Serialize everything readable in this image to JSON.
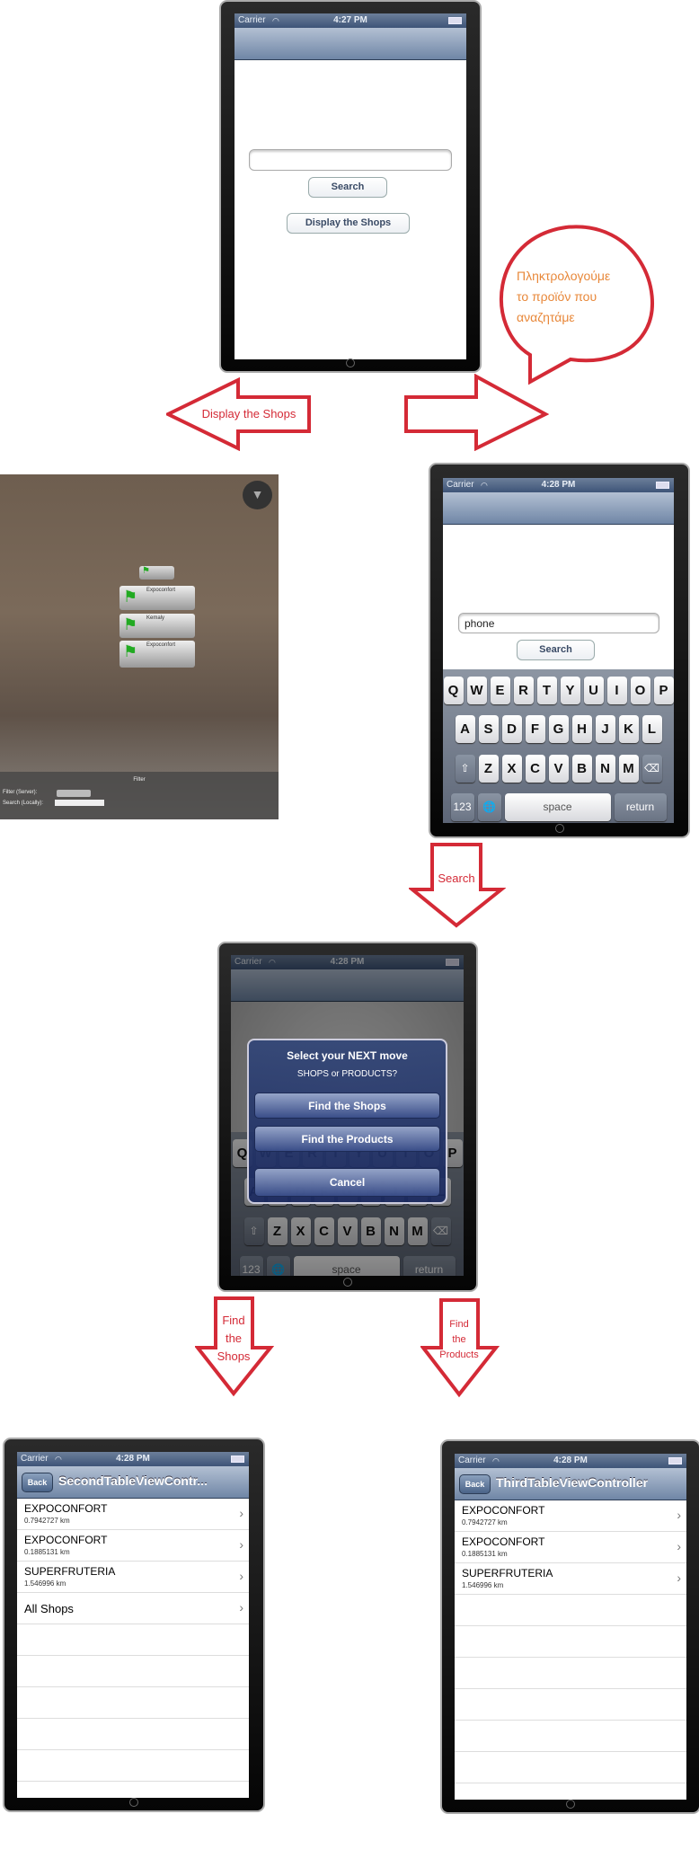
{
  "phone_home": {
    "status": {
      "carrier": "Carrier",
      "time": "4:27 PM"
    },
    "search_input": {
      "value": ""
    },
    "search_button": "Search",
    "display_shops_button": "Display the Shops"
  },
  "bubble": {
    "lines": [
      "Πληκτρολογούμε",
      "το προϊόν που",
      "αναζητάμε"
    ],
    "color": "#e8883a"
  },
  "arrows": {
    "display_shops": "Display the Shops",
    "search": "Search",
    "find_shops": [
      "Find",
      "the",
      "Shops"
    ],
    "find_products": [
      "Find",
      "the",
      "Products"
    ],
    "color": "#d42a36"
  },
  "ar_view": {
    "filter_title": "Filter",
    "filter_server_label": "Filter (Server):",
    "search_locally_label": "Search (Locally):",
    "cards": [
      "Expoconfort",
      "Kemaly",
      "Expoconfort"
    ]
  },
  "phone_search": {
    "status": {
      "carrier": "Carrier",
      "time": "4:28 PM"
    },
    "search_input": {
      "value": "phone"
    },
    "search_button": "Search"
  },
  "keyboard": {
    "rows": [
      [
        "Q",
        "W",
        "E",
        "R",
        "T",
        "Y",
        "U",
        "I",
        "O",
        "P"
      ],
      [
        "A",
        "S",
        "D",
        "F",
        "G",
        "H",
        "J",
        "K",
        "L"
      ],
      [
        "Z",
        "X",
        "C",
        "V",
        "B",
        "N",
        "M"
      ]
    ],
    "numbers": "123",
    "space": "space",
    "return": "return"
  },
  "phone_alert": {
    "status": {
      "carrier": "Carrier",
      "time": "4:28 PM"
    },
    "alert": {
      "title": "Select your NEXT move",
      "message": "SHOPS or PRODUCTS?",
      "buttons": [
        "Find the Shops",
        "Find the Products",
        "Cancel"
      ]
    }
  },
  "phone_shops": {
    "status": {
      "carrier": "Carrier",
      "time": "4:28 PM"
    },
    "back": "Back",
    "title": "SecondTableViewContr...",
    "rows": [
      {
        "name": "EXPOCONFORT",
        "distance": "0.7942727 km"
      },
      {
        "name": "EXPOCONFORT",
        "distance": "0.1885131 km"
      },
      {
        "name": "SUPERFRUTERIA",
        "distance": "1.546996 km"
      },
      {
        "name": "All Shops"
      }
    ]
  },
  "phone_products": {
    "status": {
      "carrier": "Carrier",
      "time": "4:28 PM"
    },
    "back": "Back",
    "title": "ThirdTableViewController",
    "rows": [
      {
        "name": "EXPOCONFORT",
        "distance": "0.7942727 km"
      },
      {
        "name": "EXPOCONFORT",
        "distance": "0.1885131 km"
      },
      {
        "name": "SUPERFRUTERIA",
        "distance": "1.546996 km"
      }
    ]
  }
}
